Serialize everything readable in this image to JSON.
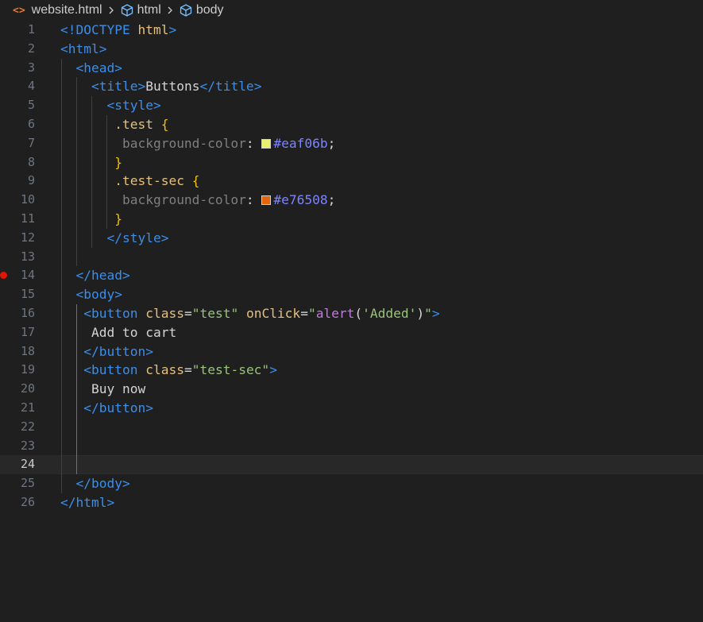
{
  "breadcrumb": {
    "file": "website.html",
    "items": [
      "html",
      "body"
    ]
  },
  "colors": {
    "swatch_test": "#eaf06b",
    "swatch_test_sec": "#e76508",
    "breakpoint": "#e51400"
  },
  "editor": {
    "current_line": 24,
    "breakpoint_line": 14,
    "line_numbers": [
      "1",
      "2",
      "3",
      "4",
      "5",
      "6",
      "7",
      "8",
      "9",
      "10",
      "11",
      "12",
      "13",
      "14",
      "15",
      "16",
      "17",
      "18",
      "19",
      "20",
      "21",
      "22",
      "23",
      "24",
      "25",
      "26"
    ],
    "lines": [
      {
        "tokens": [
          [
            "t-br",
            "<!"
          ],
          [
            "t-tag",
            "DOCTYPE"
          ],
          [
            "t-txt",
            " "
          ],
          [
            "t-kw",
            "html"
          ],
          [
            "t-br",
            ">"
          ]
        ]
      },
      {
        "tokens": [
          [
            "t-br",
            "<"
          ],
          [
            "t-tag",
            "html"
          ],
          [
            "t-br",
            ">"
          ]
        ]
      },
      {
        "tokens": [
          [
            "t-txt",
            "  "
          ],
          [
            "t-br",
            "<"
          ],
          [
            "t-tag",
            "head"
          ],
          [
            "t-br",
            ">"
          ]
        ]
      },
      {
        "tokens": [
          [
            "t-txt",
            "    "
          ],
          [
            "t-br",
            "<"
          ],
          [
            "t-tag",
            "title"
          ],
          [
            "t-br",
            ">"
          ],
          [
            "t-txt",
            "Buttons"
          ],
          [
            "t-br",
            "</"
          ],
          [
            "t-tag",
            "title"
          ],
          [
            "t-br",
            ">"
          ]
        ]
      },
      {
        "tokens": [
          [
            "t-txt",
            "      "
          ],
          [
            "t-br",
            "<"
          ],
          [
            "t-tag",
            "style"
          ],
          [
            "t-br",
            ">"
          ]
        ]
      },
      {
        "tokens": [
          [
            "t-txt",
            "       "
          ],
          [
            "t-sel",
            ".test"
          ],
          [
            "t-txt",
            " "
          ],
          [
            "t-brace",
            "{"
          ]
        ]
      },
      {
        "tokens": [
          [
            "t-txt",
            "        "
          ],
          [
            "t-prop",
            "background-color"
          ],
          [
            "t-punc",
            ": "
          ],
          [
            "swatch",
            "swatch_test"
          ],
          [
            "t-hex",
            "#eaf06b"
          ],
          [
            "t-punc",
            ";"
          ]
        ]
      },
      {
        "tokens": [
          [
            "t-txt",
            "       "
          ],
          [
            "t-brace",
            "}"
          ]
        ]
      },
      {
        "tokens": [
          [
            "t-txt",
            "       "
          ],
          [
            "t-sel",
            ".test-sec"
          ],
          [
            "t-txt",
            " "
          ],
          [
            "t-brace",
            "{"
          ]
        ]
      },
      {
        "tokens": [
          [
            "t-txt",
            "        "
          ],
          [
            "t-prop",
            "background-color"
          ],
          [
            "t-punc",
            ": "
          ],
          [
            "swatch",
            "swatch_test_sec"
          ],
          [
            "t-hex",
            "#e76508"
          ],
          [
            "t-punc",
            ";"
          ]
        ]
      },
      {
        "tokens": [
          [
            "t-txt",
            "       "
          ],
          [
            "t-brace",
            "}"
          ]
        ]
      },
      {
        "tokens": [
          [
            "t-txt",
            "      "
          ],
          [
            "t-br",
            "</"
          ],
          [
            "t-tag",
            "style"
          ],
          [
            "t-br",
            ">"
          ]
        ]
      },
      {
        "tokens": []
      },
      {
        "tokens": [
          [
            "t-txt",
            "  "
          ],
          [
            "t-br",
            "</"
          ],
          [
            "t-tag",
            "head"
          ],
          [
            "t-br",
            ">"
          ]
        ]
      },
      {
        "tokens": [
          [
            "t-txt",
            "  "
          ],
          [
            "t-br",
            "<"
          ],
          [
            "t-tag",
            "body"
          ],
          [
            "t-br",
            ">"
          ]
        ]
      },
      {
        "tokens": [
          [
            "t-txt",
            "   "
          ],
          [
            "t-br",
            "<"
          ],
          [
            "t-tag",
            "button"
          ],
          [
            "t-txt",
            " "
          ],
          [
            "t-attr",
            "class"
          ],
          [
            "t-eq",
            "="
          ],
          [
            "t-str",
            "\"test\""
          ],
          [
            "t-txt",
            " "
          ],
          [
            "t-attr",
            "onClick"
          ],
          [
            "t-eq",
            "="
          ],
          [
            "t-str",
            "\""
          ],
          [
            "t-fn",
            "alert"
          ],
          [
            "t-paren",
            "("
          ],
          [
            "t-str",
            "'Added'"
          ],
          [
            "t-paren",
            ")"
          ],
          [
            "t-str",
            "\""
          ],
          [
            "t-br",
            ">"
          ]
        ]
      },
      {
        "tokens": [
          [
            "t-txt",
            "    Add to cart"
          ]
        ]
      },
      {
        "tokens": [
          [
            "t-txt",
            "   "
          ],
          [
            "t-br",
            "</"
          ],
          [
            "t-tag",
            "button"
          ],
          [
            "t-br",
            ">"
          ]
        ]
      },
      {
        "tokens": [
          [
            "t-txt",
            "   "
          ],
          [
            "t-br",
            "<"
          ],
          [
            "t-tag",
            "button"
          ],
          [
            "t-txt",
            " "
          ],
          [
            "t-attr",
            "class"
          ],
          [
            "t-eq",
            "="
          ],
          [
            "t-str",
            "\"test-sec\""
          ],
          [
            "t-br",
            ">"
          ]
        ]
      },
      {
        "tokens": [
          [
            "t-txt",
            "    Buy now"
          ]
        ]
      },
      {
        "tokens": [
          [
            "t-txt",
            "   "
          ],
          [
            "t-br",
            "</"
          ],
          [
            "t-tag",
            "button"
          ],
          [
            "t-br",
            ">"
          ]
        ]
      },
      {
        "tokens": []
      },
      {
        "tokens": []
      },
      {
        "tokens": []
      },
      {
        "tokens": [
          [
            "t-txt",
            "  "
          ],
          [
            "t-br",
            "</"
          ],
          [
            "t-tag",
            "body"
          ],
          [
            "t-br",
            ">"
          ]
        ]
      },
      {
        "tokens": [
          [
            "t-br",
            "</"
          ],
          [
            "t-tag",
            "html"
          ],
          [
            "t-br",
            ">"
          ]
        ]
      }
    ]
  }
}
